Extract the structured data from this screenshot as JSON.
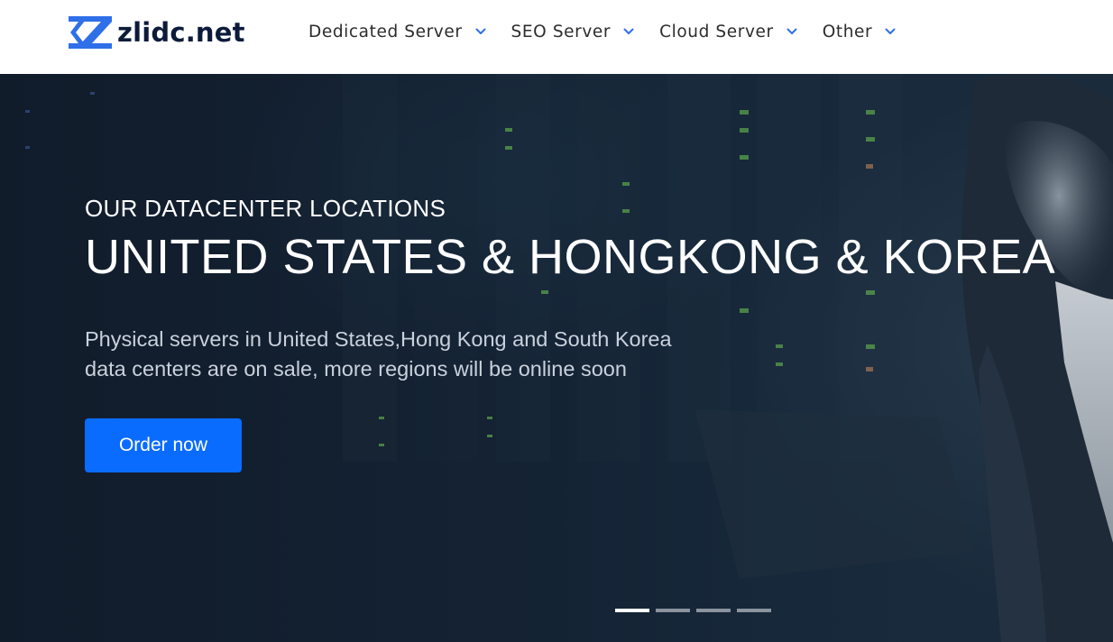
{
  "brand": {
    "name": "zlidc.net",
    "accent_color": "#2f6fe8",
    "text_color": "#0d1b3a"
  },
  "nav": {
    "items": [
      {
        "label": "Dedicated Server",
        "icon": "chevron-down-icon"
      },
      {
        "label": "SEO Server",
        "icon": "chevron-down-icon"
      },
      {
        "label": "Cloud Server",
        "icon": "chevron-down-icon"
      },
      {
        "label": "Other",
        "icon": "chevron-down-icon"
      }
    ]
  },
  "hero": {
    "eyebrow": "OUR DATACENTER LOCATIONS",
    "title": "UNITED STATES & HONGKONG & KOREA",
    "description_line1": "Physical servers in United States,Hong Kong and South Korea",
    "description_line2": "data centers are on sale, more regions will be online soon",
    "cta_label": "Order now",
    "cta_color": "#0a6cff"
  },
  "carousel": {
    "slide_count": 4,
    "active_index": 0
  }
}
